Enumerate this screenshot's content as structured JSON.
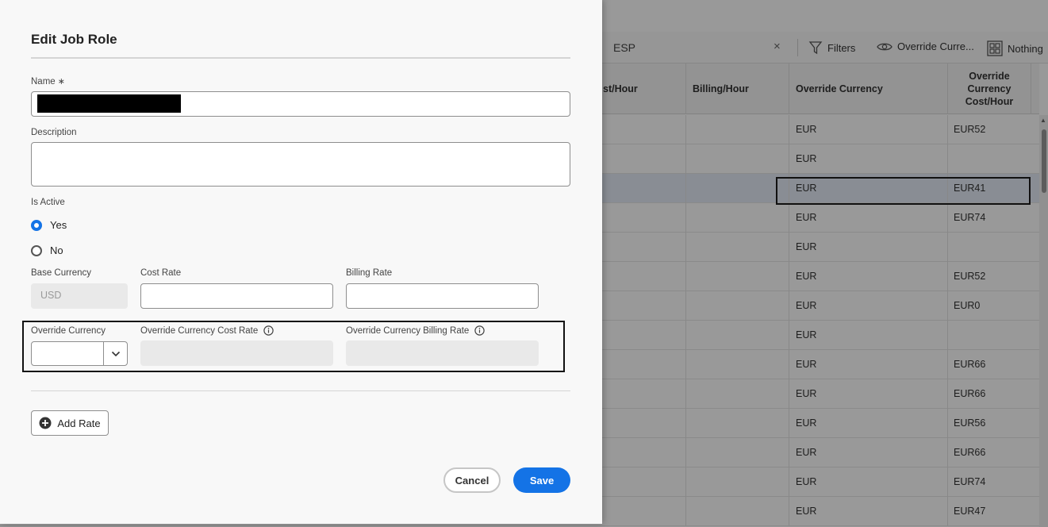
{
  "toolbar": {
    "search_value": "ESP",
    "clear_symbol": "×",
    "filters_label": "Filters",
    "override_label": "Override Curre...",
    "nothing_label": "Nothing"
  },
  "grid": {
    "headers": {
      "cost_hour": "st/Hour",
      "billing_hour": "Billing/Hour",
      "override_currency": "Override Currency",
      "override_cost_hour_1": "Override",
      "override_cost_hour_2": "Currency",
      "override_cost_hour_3": "Cost/Hour"
    },
    "rows": [
      {
        "currency": "EUR",
        "cost": "EUR52"
      },
      {
        "currency": "EUR",
        "cost": ""
      },
      {
        "currency": "EUR",
        "cost": "EUR41"
      },
      {
        "currency": "EUR",
        "cost": "EUR74"
      },
      {
        "currency": "EUR",
        "cost": ""
      },
      {
        "currency": "EUR",
        "cost": "EUR52"
      },
      {
        "currency": "EUR",
        "cost": "EUR0"
      },
      {
        "currency": "EUR",
        "cost": ""
      },
      {
        "currency": "EUR",
        "cost": "EUR66"
      },
      {
        "currency": "EUR",
        "cost": "EUR66"
      },
      {
        "currency": "EUR",
        "cost": "EUR56"
      },
      {
        "currency": "EUR",
        "cost": "EUR66"
      },
      {
        "currency": "EUR",
        "cost": "EUR74"
      },
      {
        "currency": "EUR",
        "cost": "EUR47"
      }
    ],
    "selected_row_index": 2
  },
  "dialog": {
    "title": "Edit Job Role",
    "name_label": "Name",
    "required_mark": "∗",
    "description_label": "Description",
    "is_active_label": "Is Active",
    "yes_label": "Yes",
    "no_label": "No",
    "base_currency_label": "Base Currency",
    "base_currency_value": "USD",
    "cost_rate_label": "Cost Rate",
    "billing_rate_label": "Billing Rate",
    "override_currency_label": "Override Currency",
    "override_cost_rate_label": "Override Currency Cost Rate",
    "override_billing_rate_label": "Override Currency Billing Rate",
    "add_rate_label": "Add Rate",
    "cancel_label": "Cancel",
    "save_label": "Save"
  },
  "colors": {
    "accent": "#1473e6",
    "selected_row": "#e4ecf7"
  }
}
